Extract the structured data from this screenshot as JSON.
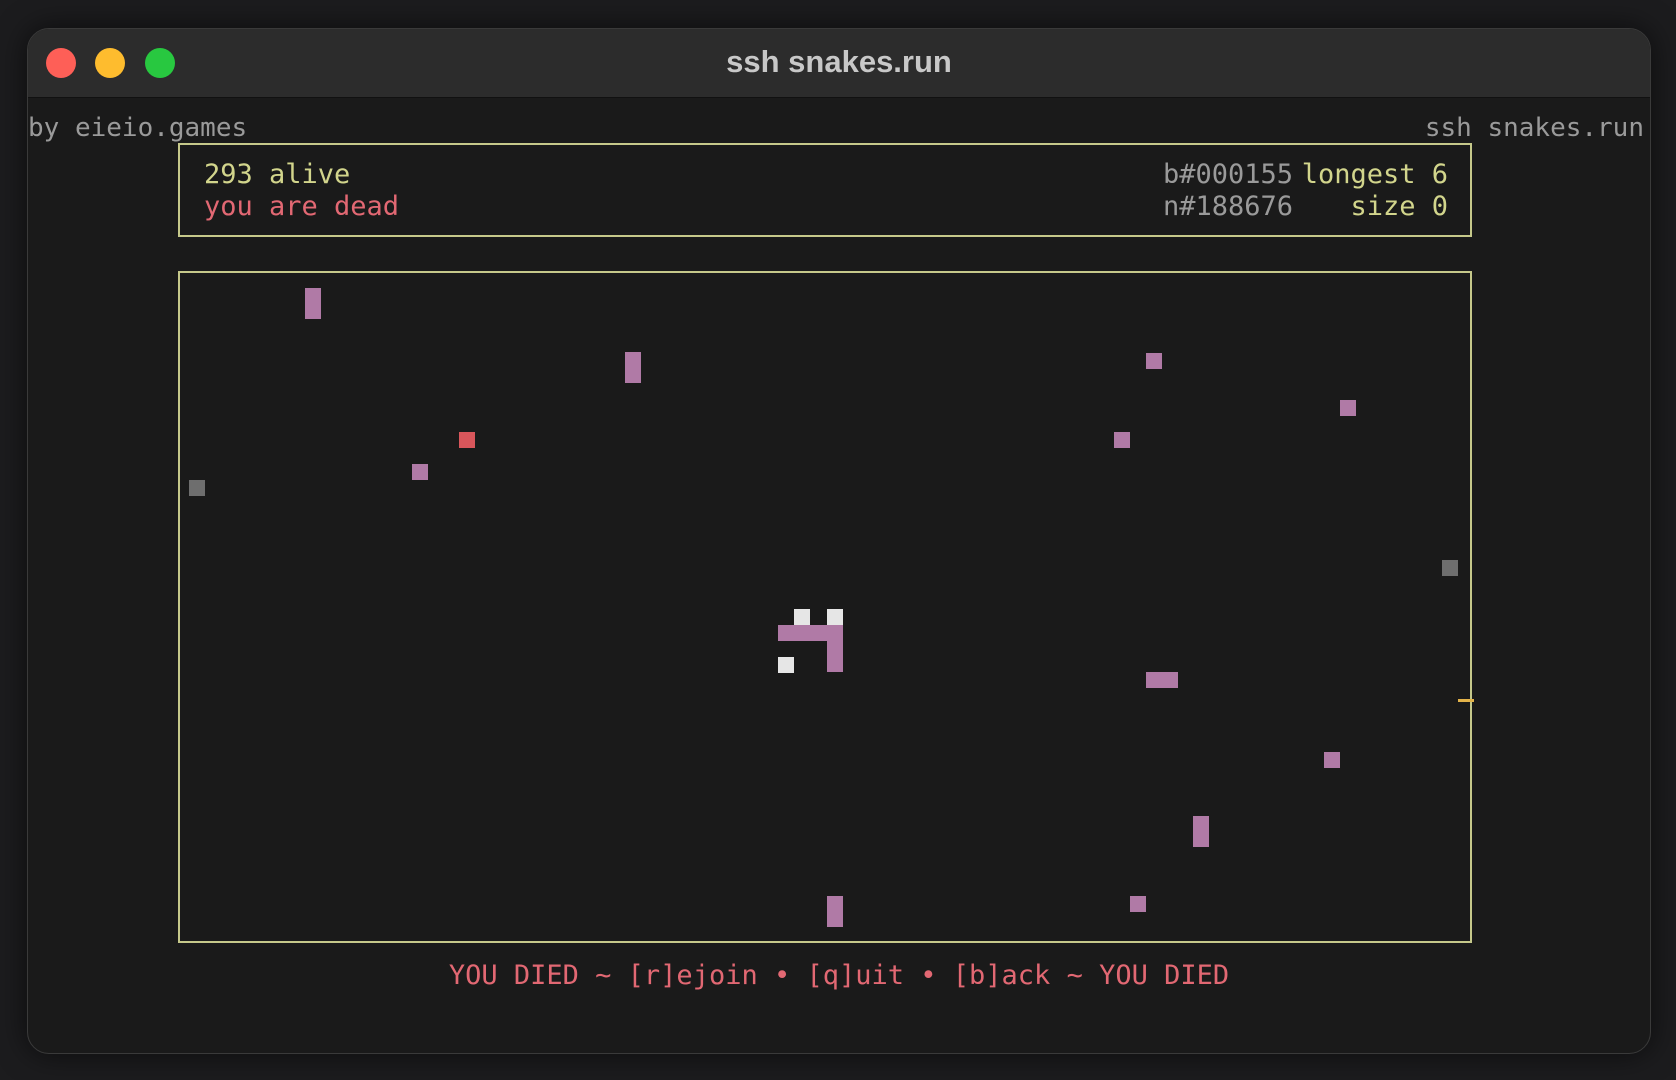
{
  "window": {
    "title": "ssh snakes.run",
    "credit": "by eieio.games",
    "hostname": "ssh snakes.run"
  },
  "status": {
    "alive": "293 alive",
    "state": "you are dead",
    "board_id": "b#000155",
    "node_id": "n#188676",
    "longest": "longest 6",
    "size": "size 0"
  },
  "footer": {
    "message": "YOU DIED ~ [r]ejoin • [q]uit • [b]ack ~ YOU DIED"
  },
  "colors": {
    "snake": "#b07aa6",
    "food": "#d9565b",
    "dead_snake": "#6e6e6e",
    "player_remains": "#e6e6e6",
    "item": "#e3b34a",
    "border": "#c5c88a",
    "alive_text": "#d2d58c",
    "dead_text": "#e26873"
  }
}
